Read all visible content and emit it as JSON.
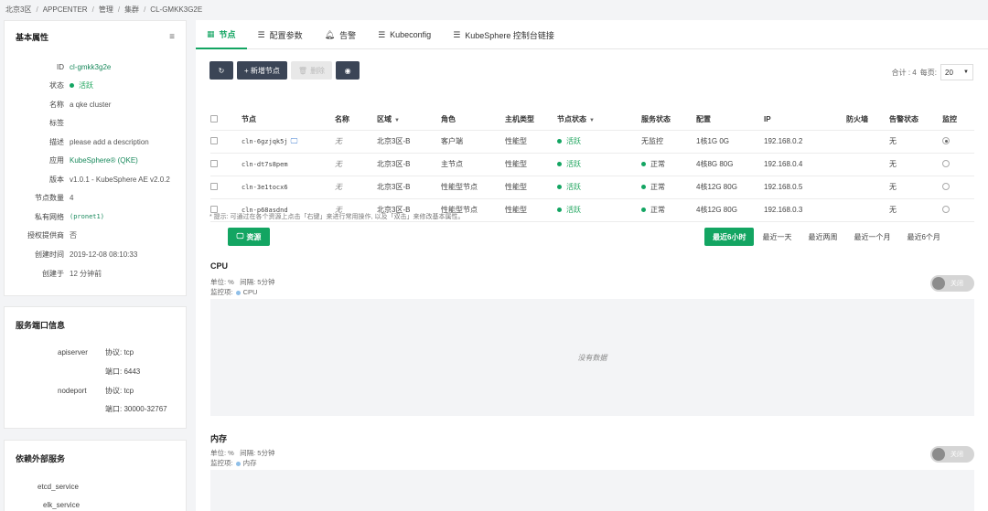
{
  "breadcrumb": [
    "北京3区",
    "APPCENTER",
    "管理",
    "集群",
    "CL-GMKK3G2E"
  ],
  "basic": {
    "title": "基本属性",
    "fields": [
      {
        "k": "ID",
        "v": "cl-gmkk3g2e"
      },
      {
        "k": "状态",
        "v": "活跃"
      },
      {
        "k": "名称",
        "v": "a qke cluster"
      },
      {
        "k": "标签",
        "v": ""
      },
      {
        "k": "描述",
        "v": "please add a description"
      },
      {
        "k": "应用",
        "v": "KubeSphere® (QKE)"
      },
      {
        "k": "版本",
        "v": "v1.0.1 - KubeSphere AE v2.0.2"
      },
      {
        "k": "节点数量",
        "v": "4"
      },
      {
        "k": "私有网络",
        "v": "(pronet1)"
      },
      {
        "k": "授权提供商",
        "v": "否"
      },
      {
        "k": "创建时间",
        "v": "2019-12-08 08:10:33"
      },
      {
        "k": "创建于",
        "v": "12 分钟前"
      }
    ]
  },
  "ports": {
    "title": "服务端口信息",
    "apiserver": {
      "name": "apiserver",
      "protocol": "协议: tcp",
      "port": "端口: 6443"
    },
    "nodeport": {
      "name": "nodeport",
      "protocol": "协议: tcp",
      "port": "端口: 30000-32767"
    }
  },
  "deps": {
    "title": "依赖外部服务",
    "items": [
      "etcd_service",
      "elk_service"
    ]
  },
  "tabs": [
    {
      "label": "节点"
    },
    {
      "label": "配置参数"
    },
    {
      "label": "告警"
    },
    {
      "label": "Kubeconfig"
    },
    {
      "label": "KubeSphere 控制台链接"
    }
  ],
  "toolbar": {
    "add": "+ 新增节点",
    "delete": "删除"
  },
  "pager": {
    "total": "合计 : 4",
    "per_page": "每页:",
    "size": "20"
  },
  "columns": [
    "节点",
    "名称",
    "区域",
    "角色",
    "主机类型",
    "节点状态",
    "服务状态",
    "配置",
    "IP",
    "防火墙",
    "告警状态",
    "监控"
  ],
  "rows": [
    {
      "id": "cln-6gzjqk5j",
      "name": "无",
      "zone": "北京3区-B",
      "role": "客户端",
      "type": "性能型",
      "status": "活跃",
      "svc": "无监控",
      "spec": "1核1G 0G",
      "ip": "192.168.0.2",
      "fw": "",
      "alarm": "无",
      "monitored": true
    },
    {
      "id": "cln-dt7s8pem",
      "name": "无",
      "zone": "北京3区-B",
      "role": "主节点",
      "type": "性能型",
      "status": "活跃",
      "svc": "正常",
      "spec": "4核8G 80G",
      "ip": "192.168.0.4",
      "fw": "",
      "alarm": "无",
      "monitored": false
    },
    {
      "id": "cln-3e1tocx6",
      "name": "无",
      "zone": "北京3区-B",
      "role": "性能型节点",
      "type": "性能型",
      "status": "活跃",
      "svc": "正常",
      "spec": "4核12G 80G",
      "ip": "192.168.0.5",
      "fw": "",
      "alarm": "无",
      "monitored": false
    },
    {
      "id": "cln-p68asdnd",
      "name": "无",
      "zone": "北京3区-B",
      "role": "性能型节点",
      "type": "性能型",
      "status": "活跃",
      "svc": "正常",
      "spec": "4核12G 80G",
      "ip": "192.168.0.3",
      "fw": "",
      "alarm": "无",
      "monitored": false
    }
  ],
  "hint": "* 提示: 可通过在各个资源上点击「右键」来进行常用操作, 以及「双击」来修改基本属性。",
  "resource_btn": "资源",
  "ranges": [
    "最近6小时",
    "最近一天",
    "最近两周",
    "最近一个月",
    "最近6个月"
  ],
  "cpu": {
    "title": "CPU",
    "unit": "单位: %",
    "interval": "间隔: 5分钟",
    "monitor": "监控项:",
    "legend": "CPU",
    "toggle": "关闭",
    "nodata": "没有数据"
  },
  "mem": {
    "title": "内存",
    "unit": "单位: %",
    "interval": "间隔: 5分钟",
    "monitor": "监控项:",
    "legend": "内存",
    "toggle": "关闭"
  }
}
